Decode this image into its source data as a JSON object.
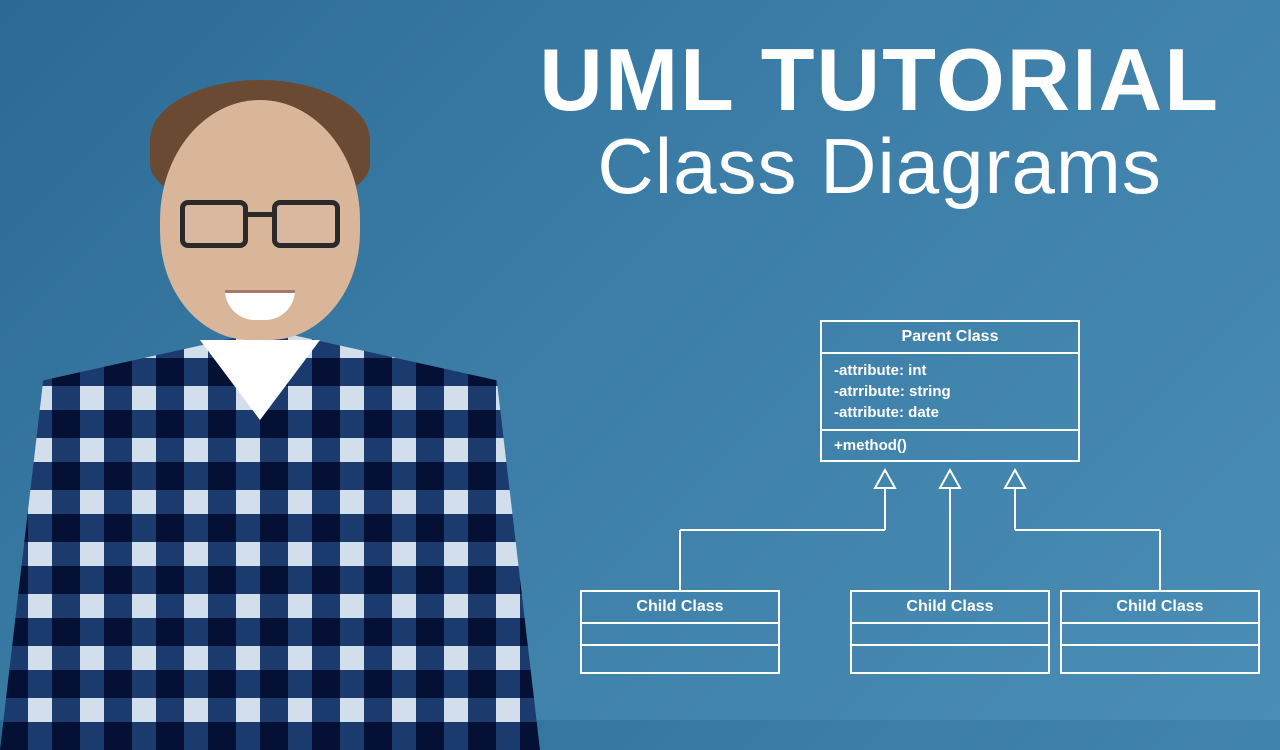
{
  "title": {
    "line1": "UML TUTORIAL",
    "line2": "Class Diagrams"
  },
  "diagram": {
    "parent": {
      "name": "Parent Class",
      "attributes": [
        "-attribute: int",
        "-atrribute: string",
        "-attribute: date"
      ],
      "methods": [
        "+method()"
      ]
    },
    "children": [
      {
        "name": "Child Class"
      },
      {
        "name": "Child Class"
      },
      {
        "name": "Child Class"
      }
    ]
  },
  "colors": {
    "background_start": "#2b6a94",
    "background_end": "#4a8db5",
    "line": "#ffffff",
    "text": "#ffffff"
  }
}
